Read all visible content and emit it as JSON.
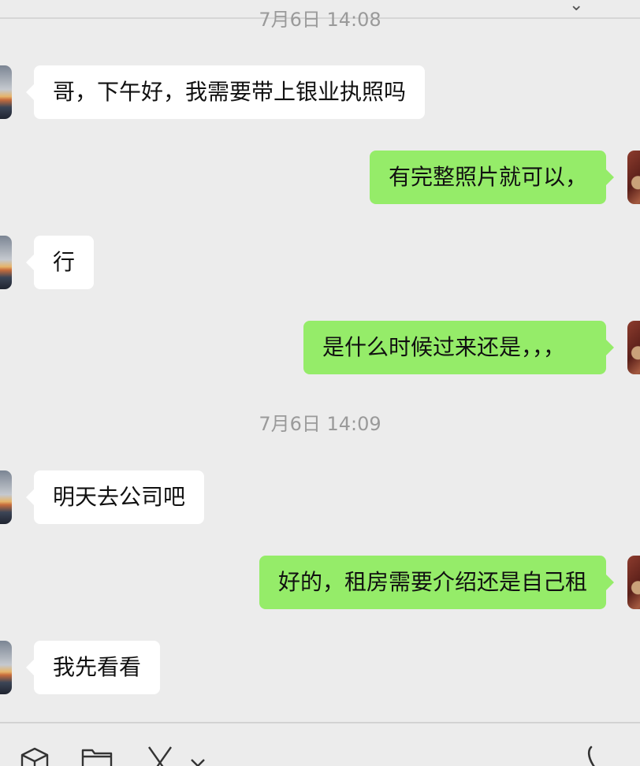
{
  "messages": [
    {
      "type": "timestamp",
      "text": "7月6日 14:08"
    },
    {
      "type": "in",
      "text": "哥，下午好，我需要带上银业执照吗"
    },
    {
      "type": "out",
      "text": "有完整照片就可以，"
    },
    {
      "type": "in",
      "text": "行"
    },
    {
      "type": "out",
      "text": "是什么时候过来还是，，，"
    },
    {
      "type": "timestamp",
      "text": "7月6日 14:09"
    },
    {
      "type": "in",
      "text": "明天去公司吧"
    },
    {
      "type": "out",
      "text": "好的，租房需要介绍还是自己租"
    },
    {
      "type": "in",
      "text": "我先看看"
    }
  ],
  "toolbar": {
    "icons": [
      "emoji-icon",
      "folder-icon",
      "scissors-icon",
      "chevron-down-icon",
      "phone-icon"
    ]
  },
  "colors": {
    "background": "#ececec",
    "incoming_bubble": "#ffffff",
    "outgoing_bubble": "#95ec69",
    "timestamp_text": "#9a9a9a"
  }
}
